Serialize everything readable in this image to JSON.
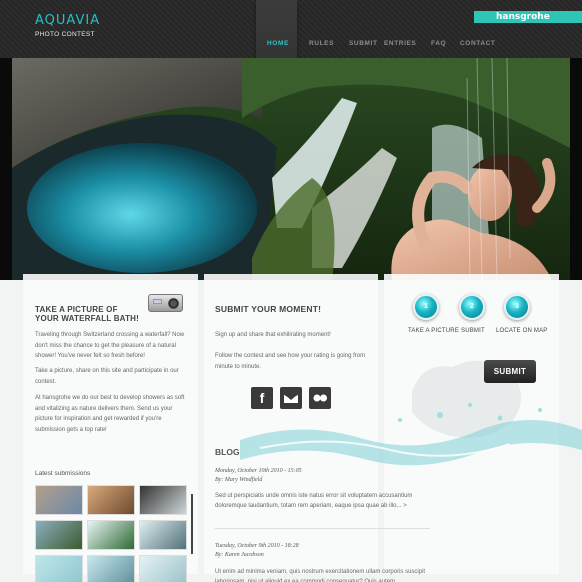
{
  "header": {
    "title": "AQUAVIA",
    "subtitle": "PHOTO CONTEST",
    "brand": "hansgrohe",
    "nav": [
      "HOME",
      "RULES",
      "SUBMIT",
      "ENTRIES",
      "FAQ",
      "CONTACT"
    ],
    "active_nav": "HOME"
  },
  "left": {
    "heading_line1": "TAKE A PICTURE OF",
    "heading_line2": "YOUR WATERFALL BATH!",
    "p1": "Traveling through Switzerland crossing a waterfall? Now don't miss the chance to get the pleasure of a natural shower! You've never felt so fresh before!",
    "p2": "Take a picture, share on this site and participate in our contest.",
    "p3": "At hansgrohe we do our best to develop showers as soft and vitalizing as nature delivers them. Send us your picture for inspiration and get rewarded if you're submission gets a top rate!",
    "latest_label": "Latest submissions"
  },
  "middle": {
    "heading": "SUBMIT YOUR MOMENT!",
    "p1": "Sign up and share that exhilirating moment!",
    "p2": "Follow the contest and see how your rating is going from minute to minute.",
    "social": [
      "f",
      "t",
      "flickr"
    ],
    "blog_title": "BLOG",
    "posts": [
      {
        "date": "Monday, October 10th  2010 - 15:05",
        "author": "By: Mary Windfield",
        "excerpt": "Sed ut perspiciatis unde omnis iste natus error sit voluptatem accusantium doloremque laudantium, totam rem aperiam, eaque ipsa quae ab illo... >"
      },
      {
        "date": "Tuesday, October 9th 2010 - 18:28",
        "author": "By: Karen Jacobson",
        "excerpt": "Ut enim ad minima veniam, quis nostrum exercitationem ullam corporis suscipit laboriosam, nisi ut aliquid ex ea commodi consequatur? Quis autem"
      }
    ]
  },
  "right": {
    "steps": [
      {
        "num": "1",
        "label": "TAKE A PICTURE"
      },
      {
        "num": "2",
        "label": "SUBMIT"
      },
      {
        "num": "3",
        "label": "LOCATE ON MAP"
      }
    ],
    "submit_label": "SUBMIT"
  },
  "colors": {
    "accent": "#2ec4c6",
    "brand": "#2ec4b6",
    "header_bg": "#2a2a2a"
  }
}
